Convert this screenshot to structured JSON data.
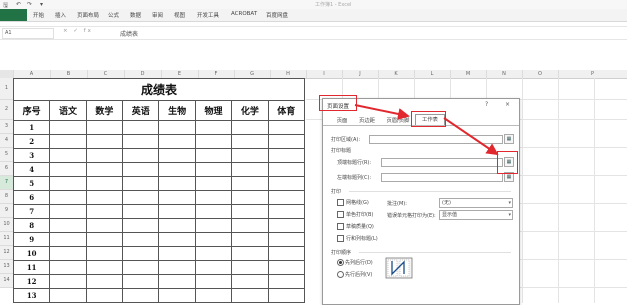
{
  "window": {
    "title": "工作簿1 - Excel"
  },
  "ribbon": {
    "tabs": [
      "开始",
      "插入",
      "页面布局",
      "公式",
      "数据",
      "审阅",
      "视图",
      "开发工具",
      "ACROBAT",
      "百度网盘"
    ]
  },
  "formula_bar": {
    "name_box": "A1",
    "icons": "× ✓ fx",
    "content": "成绩表"
  },
  "grid": {
    "columns": [
      "A",
      "B",
      "C",
      "D",
      "E",
      "F",
      "G",
      "H",
      "I",
      "J",
      "K",
      "L",
      "M",
      "N",
      "O",
      "P"
    ],
    "rows": [
      "1",
      "2",
      "3",
      "4",
      "5",
      "6",
      "7",
      "8",
      "9",
      "10",
      "11",
      "12",
      "13",
      "14"
    ]
  },
  "table": {
    "title": "成绩表",
    "headers": [
      "序号",
      "语文",
      "数学",
      "英语",
      "生物",
      "物理",
      "化学",
      "体育"
    ],
    "row_numbers": [
      "1",
      "2",
      "3",
      "4",
      "5",
      "6",
      "7",
      "8",
      "9",
      "10",
      "11",
      "12",
      "13"
    ]
  },
  "dialog": {
    "title": "页面设置",
    "help": "?",
    "close": "×",
    "tabs": [
      "页面",
      "页边距",
      "页眉/页脚",
      "工作表"
    ],
    "active_tab": "工作表",
    "print_area_label": "打印区域(A):",
    "print_titles_label": "打印标题",
    "rows_to_repeat_label": "顶端标题行(R):",
    "cols_to_repeat_label": "左端标题列(C):",
    "print_section_label": "打印",
    "gridlines_label": "网格线(G)",
    "bw_label": "单色打印(B)",
    "draft_label": "草稿质量(Q)",
    "headings_label": "行和列标题(L)",
    "comments_label": "批注(M):",
    "comments_value": "(无)",
    "errors_label": "错误单元格打印为(E):",
    "errors_value": "显示值",
    "page_order_label": "打印顺序",
    "down_then_over": "先列后行(D)",
    "over_then_down": "先行后列(V)"
  },
  "colors": {
    "excel_green": "#217346",
    "annotation_red": "#e0282e"
  }
}
